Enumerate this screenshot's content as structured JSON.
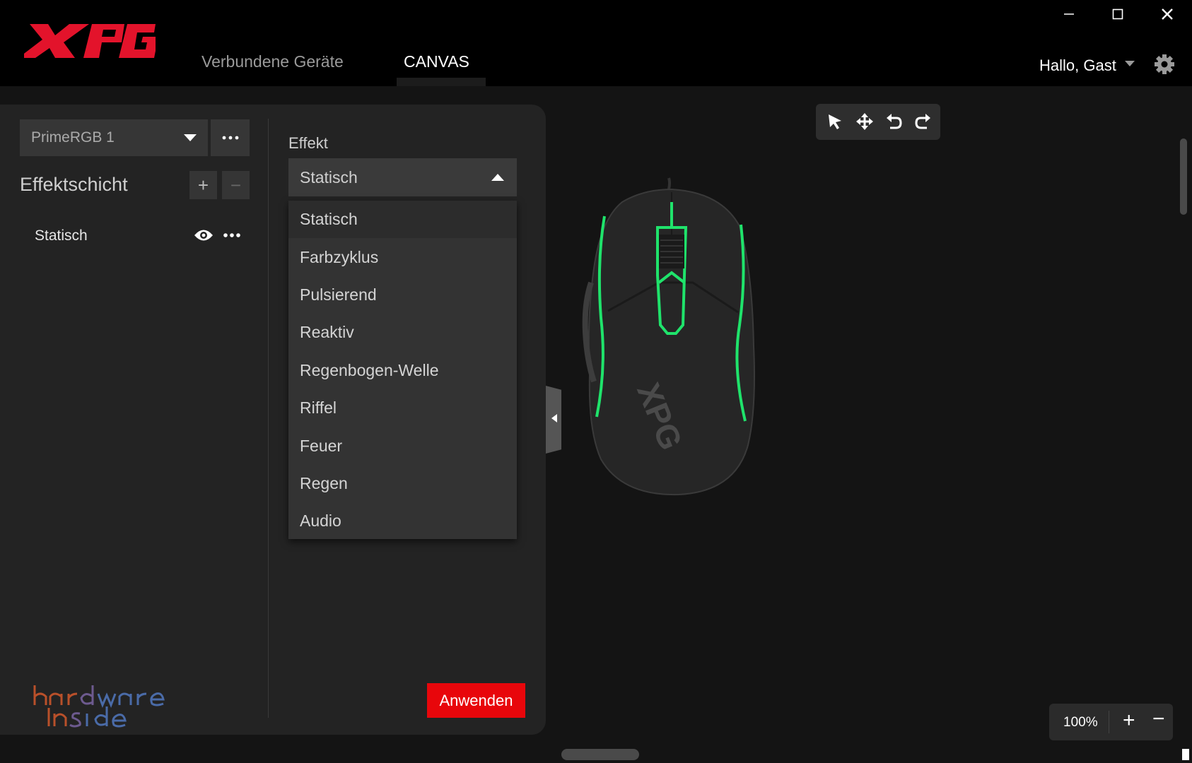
{
  "nav": {
    "tabs": [
      {
        "label": "Verbundene Geräte"
      },
      {
        "label": "CANVAS"
      }
    ],
    "user_greeting": "Hallo, Gast"
  },
  "device": {
    "selected": "PrimeRGB 1"
  },
  "layers": {
    "title": "Effektschicht",
    "add_label": "+",
    "remove_label": "−",
    "items": [
      {
        "name": "Statisch"
      }
    ]
  },
  "effect": {
    "label": "Effekt",
    "selected": "Statisch",
    "options": [
      "Statisch",
      "Farbzyklus",
      "Pulsierend",
      "Reaktiv",
      "Regenbogen-Welle",
      "Riffel",
      "Feuer",
      "Regen",
      "Audio"
    ]
  },
  "apply_label": "Anwenden",
  "zoom": {
    "value": "100%",
    "plus": "+",
    "minus": "−"
  },
  "colors": {
    "accent": "#e8060b",
    "glow": "#1fe36b",
    "logo": "#e3132b"
  }
}
